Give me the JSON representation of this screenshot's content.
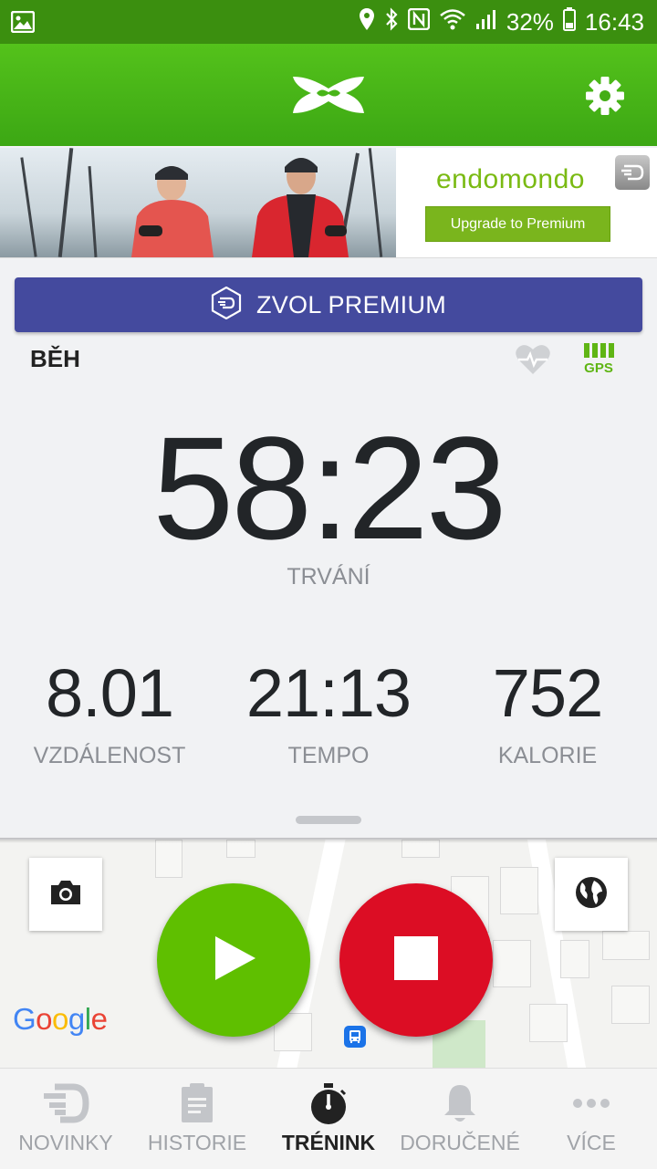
{
  "status_bar": {
    "battery": "32%",
    "time": "16:43"
  },
  "banner": {
    "brand": "endomondo",
    "upgrade_label": "Upgrade to Premium"
  },
  "premium_button": {
    "label": "ZVOL PREMIUM"
  },
  "workout": {
    "sport": "BĚH",
    "gps_label": "GPS",
    "duration": "58:23",
    "duration_label": "TRVÁNÍ",
    "metrics": [
      {
        "value": "8.01",
        "label": "VZDÁLENOST"
      },
      {
        "value": "21:13",
        "label": "TEMPO"
      },
      {
        "value": "752",
        "label": "KALORIE"
      }
    ]
  },
  "map": {
    "google_letters": [
      "G",
      "o",
      "o",
      "g",
      "l",
      "e"
    ],
    "google_colors": [
      "#4285f4",
      "#ea4335",
      "#fbbc05",
      "#4285f4",
      "#34a853",
      "#ea4335"
    ]
  },
  "colors": {
    "header_green": "#3ca714",
    "premium_purple": "#444a9e",
    "play_green": "#5fbf00",
    "stop_red": "#dc0d24"
  },
  "nav": {
    "items": [
      {
        "label": "NOVINKY",
        "icon": "feed-icon",
        "active": false
      },
      {
        "label": "HISTORIE",
        "icon": "history-icon",
        "active": false
      },
      {
        "label": "TRÉNINK",
        "icon": "stopwatch-icon",
        "active": true
      },
      {
        "label": "DORUČENÉ",
        "icon": "bell-icon",
        "active": false
      },
      {
        "label": "VÍCE",
        "icon": "more-icon",
        "active": false
      }
    ]
  }
}
